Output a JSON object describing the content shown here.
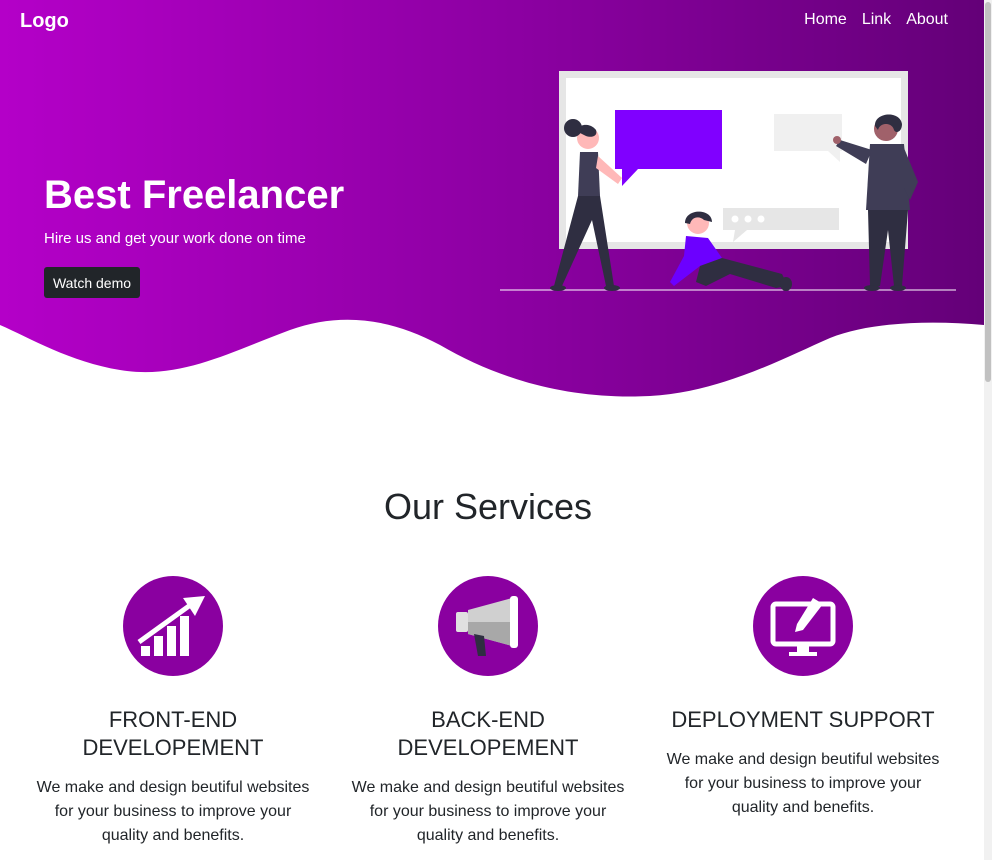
{
  "nav": {
    "logo": "Logo",
    "links": [
      "Home",
      "Link",
      "About"
    ]
  },
  "hero": {
    "title": "Best Freelancer",
    "subtitle": "Hire us and get your work done on time",
    "button_label": "Watch demo"
  },
  "services": {
    "title": "Our Services",
    "items": [
      {
        "title": "FRONT-END DEVELOPEMENT",
        "text": "We make and design beutiful websites for your business to improve your quality and benefits.",
        "icon": "growth-chart-icon"
      },
      {
        "title": "BACK-END DEVELOPEMENT",
        "text": "We make and design beutiful websites for your business to improve your quality and benefits.",
        "icon": "megaphone-icon"
      },
      {
        "title": "DEPLOYMENT SUPPORT",
        "text": "We make and design beutiful websites for your business to improve your quality and benefits.",
        "icon": "monitor-pen-icon"
      }
    ]
  },
  "colors": {
    "hero_gradient_start": "#b400c8",
    "hero_gradient_end": "#6a0080",
    "accent": "#8a00a0",
    "button": "#212529"
  }
}
